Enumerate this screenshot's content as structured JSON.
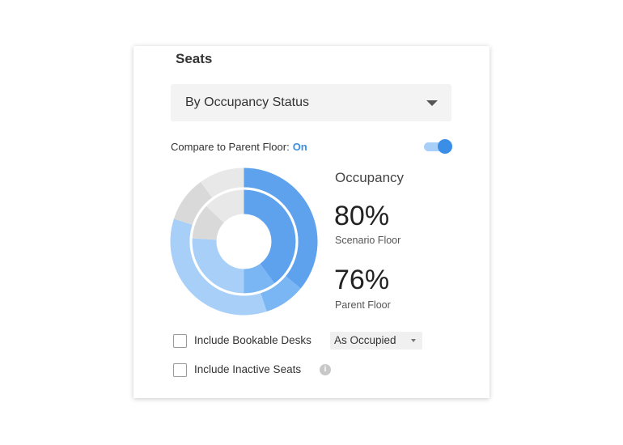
{
  "panel": {
    "title": "Seats",
    "dropdown": {
      "selected": "By Occupancy Status"
    },
    "compare": {
      "label": "Compare to Parent Floor:",
      "state": "On",
      "toggle_on": true
    },
    "occupancy": {
      "title": "Occupancy",
      "scenario": {
        "value": "80%",
        "label": "Scenario Floor"
      },
      "parent": {
        "value": "76%",
        "label": "Parent Floor"
      }
    },
    "options": [
      {
        "label": "Include Bookable Desks",
        "checked": false,
        "select_value": "As Occupied"
      },
      {
        "label": "Include Inactive Seats",
        "checked": false,
        "info_icon": "info-icon"
      }
    ]
  },
  "chart_data": {
    "type": "donut",
    "rings": [
      {
        "name": "outer",
        "segments": [
          {
            "value": 36,
            "color": "#5ea2ee"
          },
          {
            "value": 9,
            "color": "#7ab6f3"
          },
          {
            "value": 35,
            "color": "#a8cff8"
          },
          {
            "value": 10,
            "color": "#d9d9d9"
          },
          {
            "value": 10,
            "color": "#e8e8e8"
          }
        ]
      },
      {
        "name": "inner",
        "segments": [
          {
            "value": 40,
            "color": "#5ea2ee"
          },
          {
            "value": 10,
            "color": "#7ab6f3"
          },
          {
            "value": 26,
            "color": "#a8cff8"
          },
          {
            "value": 11,
            "color": "#d9d9d9"
          },
          {
            "value": 13,
            "color": "#e8e8e8"
          }
        ]
      }
    ]
  },
  "colors": {
    "accent": "#3a8ee6"
  }
}
